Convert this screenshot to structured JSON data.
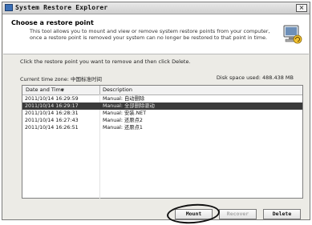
{
  "window": {
    "title": "System Restore Explorer",
    "close_glyph": "×"
  },
  "header": {
    "title": "Choose a restore point",
    "description": "This tool allows you to mount and view or remove system restore points from your computer, once a restore point is removed your system can no longer be restored to that point in time."
  },
  "main": {
    "instruction": "Click the restore point you want to remove and then click Delete.",
    "timezone_label": "Current time zone:",
    "timezone_value": "中国标准时间",
    "disk_space_label": "Disk space used:",
    "disk_space_value": "488.438 MB"
  },
  "list": {
    "columns": [
      "Date and Time",
      "Description"
    ],
    "sort_glyph": "▼",
    "rows": [
      {
        "date": "2011/10/14 16:29:59",
        "desc": "Manual: 自动删除"
      },
      {
        "date": "2011/10/14 16:29:17",
        "desc": "Manual: 全部删除驱动",
        "selected": true
      },
      {
        "date": "2011/10/14 16:28:31",
        "desc": "Manual: 安装.NET"
      },
      {
        "date": "2011/10/14 16:27:43",
        "desc": "Manual: 还原点2"
      },
      {
        "date": "2011/10/14 16:26:51",
        "desc": "Manual: 还原点1"
      }
    ]
  },
  "buttons": {
    "mount": "Mount",
    "recover": "Recover",
    "delete": "Delete"
  },
  "colors": {
    "selected_row": "#3a3a3a",
    "window_bg": "#ecebe6"
  }
}
